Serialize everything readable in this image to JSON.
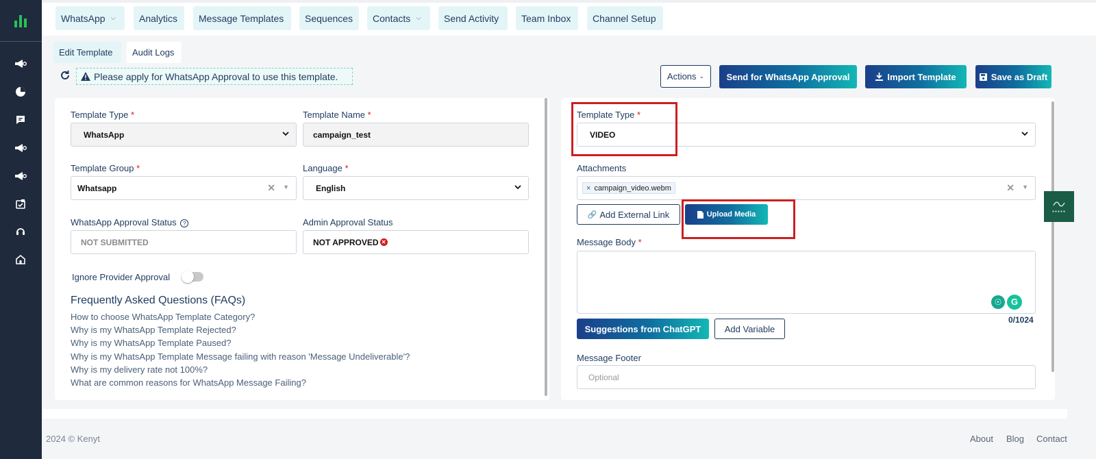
{
  "nav": {
    "items": [
      {
        "label": "WhatsApp",
        "dropdown": true
      },
      {
        "label": "Analytics",
        "dropdown": false
      },
      {
        "label": "Message Templates",
        "dropdown": false
      },
      {
        "label": "Sequences",
        "dropdown": false
      },
      {
        "label": "Contacts",
        "dropdown": true
      },
      {
        "label": "Send Activity",
        "dropdown": false
      },
      {
        "label": "Team Inbox",
        "dropdown": false
      },
      {
        "label": "Channel Setup",
        "dropdown": false
      }
    ]
  },
  "tabs": {
    "edit": "Edit Template",
    "audit": "Audit Logs"
  },
  "notice": "Please apply for WhatsApp Approval to use this template.",
  "actions": {
    "actions_label": "Actions",
    "send_label": "Send for WhatsApp Approval",
    "import_label": "Import Template",
    "save_label": "Save as Draft"
  },
  "left": {
    "template_type_label": "Template Type",
    "template_type_value": "WhatsApp",
    "template_name_label": "Template Name",
    "template_name_value": "campaign_test",
    "template_group_label": "Template Group",
    "template_group_value": "Whatsapp",
    "language_label": "Language",
    "language_value": "English",
    "wa_status_label": "WhatsApp Approval Status",
    "wa_status_value": "NOT SUBMITTED",
    "admin_status_label": "Admin Approval Status",
    "admin_status_value": "NOT APPROVED",
    "ignore_label": "Ignore Provider Approval",
    "ignore_on": false
  },
  "faq": {
    "title": "Frequently Asked Questions (FAQs)",
    "items": [
      "How to choose WhatsApp Template Category?",
      "Why is my WhatsApp Template Rejected?",
      "Why is my WhatsApp Template Paused?",
      "Why is my WhatsApp Template Message failing with reason 'Message Undeliverable'?",
      "Why is my delivery rate not 100%?",
      "What are common reasons for WhatsApp Message Failing?"
    ]
  },
  "right": {
    "template_type_label": "Template Type",
    "template_type_value": "VIDEO",
    "attachments_label": "Attachments",
    "attachment_chip": "campaign_video.webm",
    "chip_remove": "×",
    "add_link_label": "Add External Link",
    "upload_label": "Upload Media",
    "body_label": "Message Body",
    "body_counter": "0/1024",
    "chatgpt_label": "Suggestions from ChatGPT",
    "add_variable_label": "Add Variable",
    "footer_label": "Message Footer",
    "footer_placeholder": "Optional"
  },
  "required_mark": "*",
  "footer": {
    "copyright": "2024 © Kenyt",
    "about": "About",
    "blog": "Blog",
    "contact": "Contact"
  },
  "colors": {
    "accent": "#1b3f8a",
    "teal": "#13b7b5",
    "sidebar": "#1f2a3c",
    "highlight": "#cc1f1f"
  }
}
